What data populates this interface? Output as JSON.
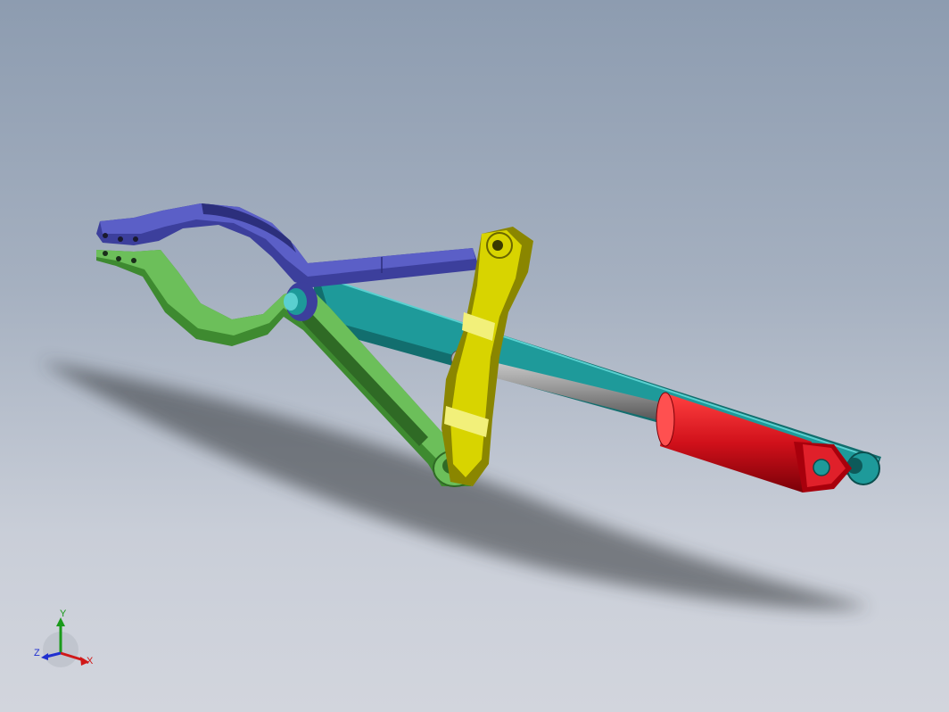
{
  "scene": {
    "background_top": "#8d9cb0",
    "background_bottom": "#d2d5dd",
    "parts": [
      {
        "name": "upper-jaw-arm",
        "color": "#5b5fc7"
      },
      {
        "name": "lower-jaw-arm",
        "color": "#6cbf5a"
      },
      {
        "name": "connecting-link",
        "color": "#1e9a9a"
      },
      {
        "name": "bracket-link",
        "color": "#d8d400"
      },
      {
        "name": "hydraulic-cylinder",
        "color": "#d0101a"
      },
      {
        "name": "piston-rod",
        "color": "#9a9a9a"
      }
    ]
  },
  "triad": {
    "x_label": "X",
    "y_label": "Y",
    "z_label": "Z",
    "x_color": "#d01818",
    "y_color": "#1a9a1a",
    "z_color": "#2030d0"
  }
}
